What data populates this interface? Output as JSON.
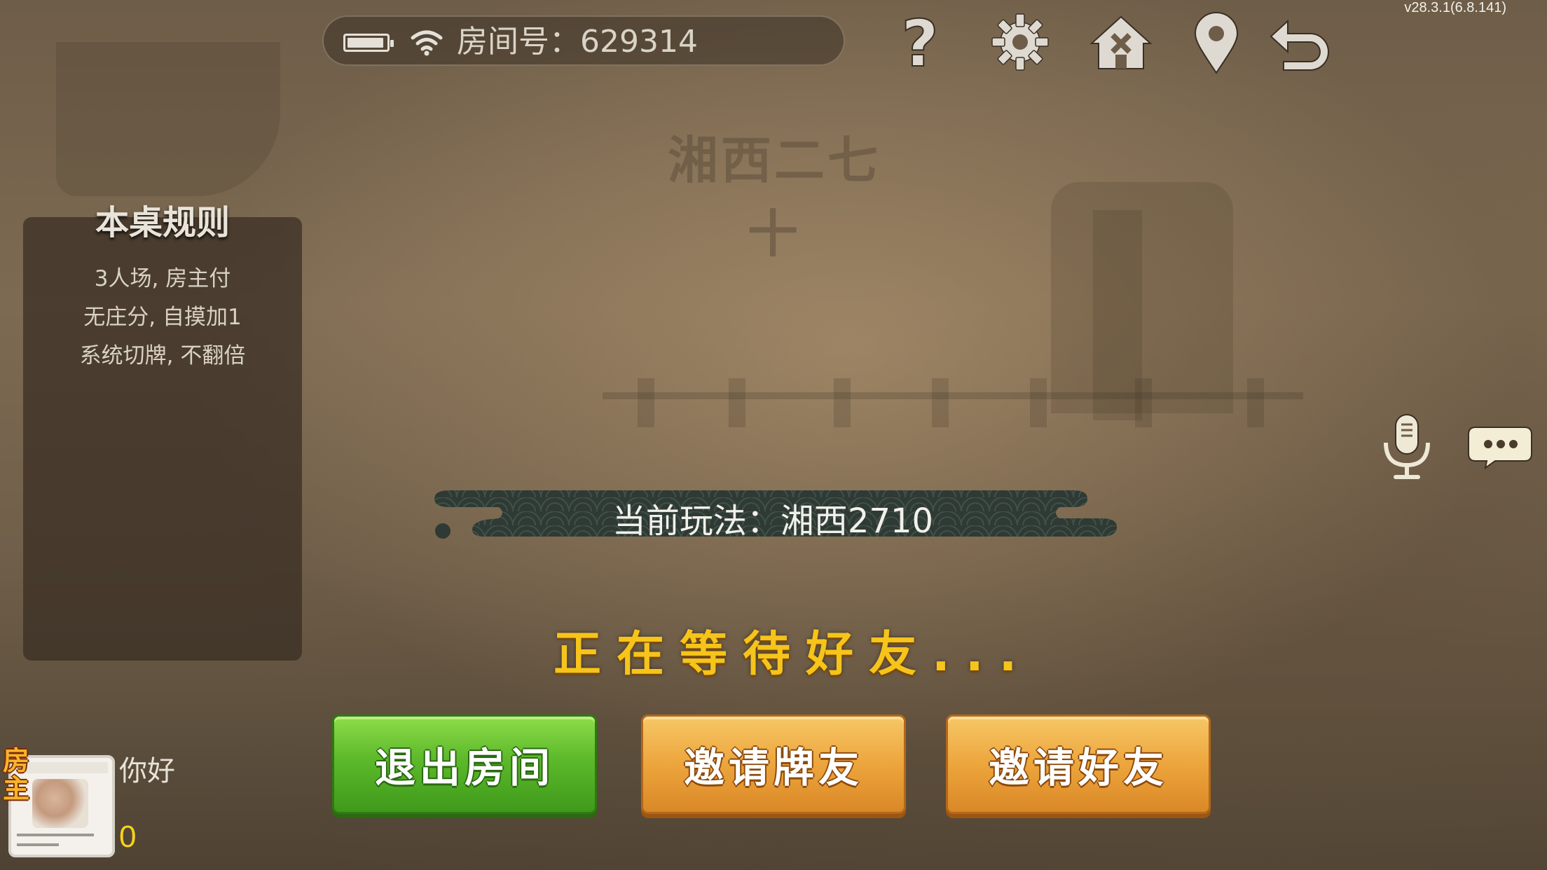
{
  "status_bar": {
    "room_label": "房间号：629314",
    "battery_icon": "battery-icon",
    "wifi_icon": "wifi-icon"
  },
  "version": "v28.3.1(6.8.141)",
  "toolbar": {
    "help_icon": "help-icon",
    "settings_icon": "gear-icon",
    "home_icon": "home-icon",
    "location_icon": "location-pin-icon",
    "back_icon": "back-arrow-icon"
  },
  "game_title": "湘西二七十",
  "rules": {
    "title": "本桌规则",
    "lines": [
      "3人场, 房主付",
      "无庄分, 自摸加1",
      "系统切牌, 不翻倍"
    ]
  },
  "current_mode": "当前玩法：湘西2710",
  "waiting_text": "正在等待好友...",
  "buttons": {
    "exit": "退出房间",
    "invite_card_friends": "邀请牌友",
    "invite_friends": "邀请好友"
  },
  "side_controls": {
    "mic_icon": "microphone-icon",
    "chat_icon": "chat-bubble-icon"
  },
  "player": {
    "owner_badge": "房主",
    "name": "你好",
    "score": "0"
  },
  "colors": {
    "accent_yellow": "#f6c41a",
    "exit_green": "#5cb92a",
    "invite_orange": "#eda53d"
  }
}
